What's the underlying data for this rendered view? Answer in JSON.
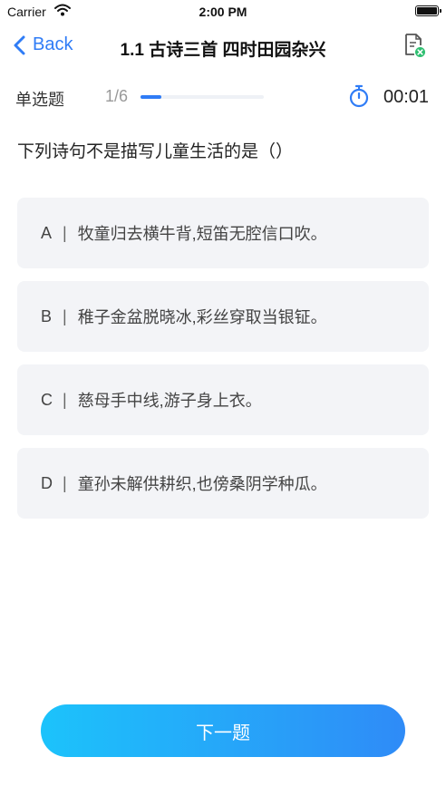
{
  "status_bar": {
    "carrier": "Carrier",
    "time": "2:00 PM"
  },
  "nav": {
    "back_label": "Back",
    "title": "1.1 古诗三首 四时田园杂兴"
  },
  "quiz": {
    "question_type": "单选题",
    "progress_text": "1/6",
    "progress_fraction": 0.167,
    "timer": "00:01",
    "question": "下列诗句不是描写儿童生活的是（）",
    "separator": "|",
    "options": [
      {
        "letter": "A",
        "text": "牧童归去横牛背,短笛无腔信口吹。"
      },
      {
        "letter": "B",
        "text": "稚子金盆脱晓冰,彩丝穿取当银钲。"
      },
      {
        "letter": "C",
        "text": "慈母手中线,游子身上衣。"
      },
      {
        "letter": "D",
        "text": "童孙未解供耕织,也傍桑阴学种瓜。"
      }
    ],
    "next_label": "下一题"
  },
  "colors": {
    "accent": "#2f7cf6",
    "button_start": "#1cc3fb",
    "button_end": "#2f8bf7",
    "option_bg": "#f3f4f7"
  },
  "icons": {
    "back": "chevron-left-icon",
    "doc": "document-close-icon",
    "timer": "stopwatch-icon"
  }
}
